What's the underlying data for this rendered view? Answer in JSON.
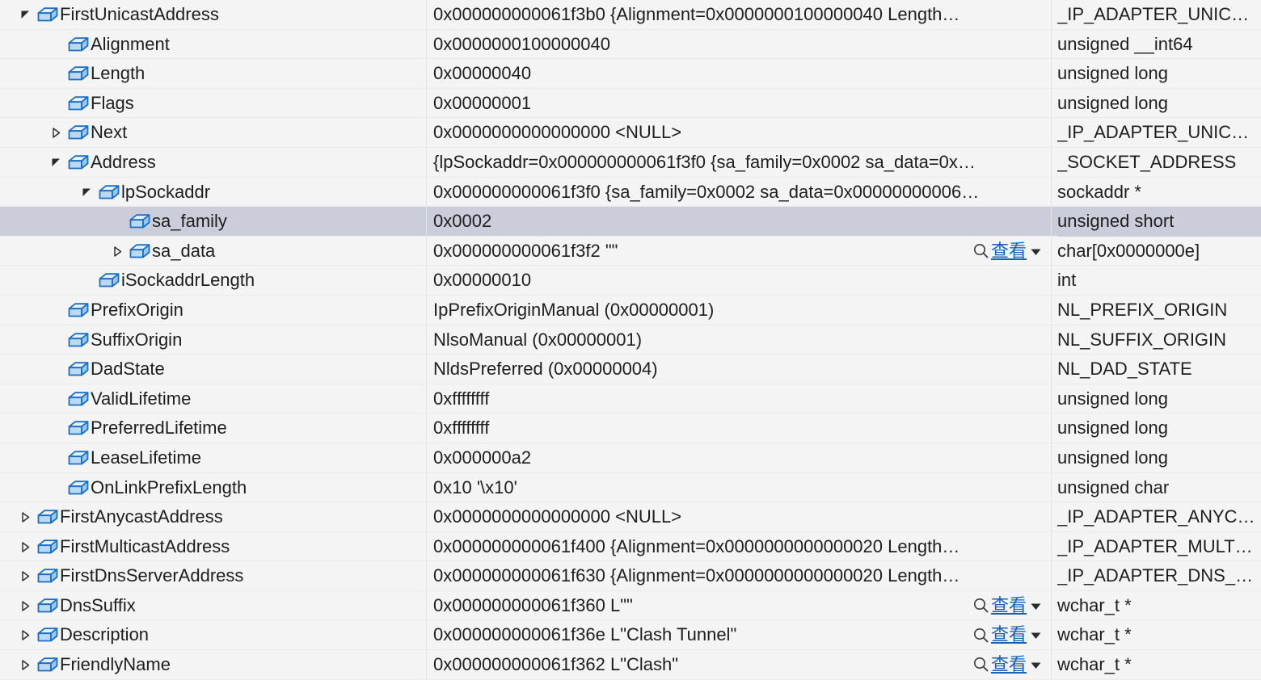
{
  "window": {
    "kind": "debugger-variable-tree",
    "selected_row_index": 7,
    "colors": {
      "row_background": "#f4f4f4",
      "row_divider": "#ebebeb",
      "selection": "#cbcdda",
      "text": "#1e1e1e",
      "link": "#1763b5",
      "icon_outline": "#1a6fc4",
      "icon_fill": "#cfe2f5"
    }
  },
  "visualizer": {
    "label": "查看",
    "magnifier_icon": "search-icon",
    "caret_icon": "chevron-down-icon"
  },
  "icons": {
    "field": "field-cube-icon",
    "expanded": "triangle-expanded-icon",
    "collapsed": "triangle-collapsed-icon",
    "pin": "pin-icon"
  },
  "rows": [
    {
      "indent": 1,
      "twisty": "expanded",
      "name": "FirstUnicastAddress",
      "pin": true,
      "value": "0x000000000061f3b0 {Alignment=0x0000000100000040 Length…",
      "visualizer": false,
      "type": "_IP_ADAPTER_UNIC…"
    },
    {
      "indent": 2,
      "twisty": "none",
      "name": "Alignment",
      "pin": false,
      "value": "0x0000000100000040",
      "visualizer": false,
      "type": "unsigned __int64"
    },
    {
      "indent": 2,
      "twisty": "none",
      "name": "Length",
      "pin": false,
      "value": "0x00000040",
      "visualizer": false,
      "type": "unsigned long"
    },
    {
      "indent": 2,
      "twisty": "none",
      "name": "Flags",
      "pin": false,
      "value": "0x00000001",
      "visualizer": false,
      "type": "unsigned long"
    },
    {
      "indent": 2,
      "twisty": "collapsed",
      "name": "Next",
      "pin": false,
      "value": "0x0000000000000000 <NULL>",
      "visualizer": false,
      "type": "_IP_ADAPTER_UNIC…"
    },
    {
      "indent": 2,
      "twisty": "expanded",
      "name": "Address",
      "pin": false,
      "value": "{lpSockaddr=0x000000000061f3f0 {sa_family=0x0002 sa_data=0x…",
      "visualizer": false,
      "type": "_SOCKET_ADDRESS"
    },
    {
      "indent": 3,
      "twisty": "expanded",
      "name": "lpSockaddr",
      "pin": false,
      "value": "0x000000000061f3f0 {sa_family=0x0002 sa_data=0x00000000006…",
      "visualizer": false,
      "type": "sockaddr *"
    },
    {
      "indent": 4,
      "twisty": "none",
      "name": "sa_family",
      "pin": false,
      "value": "0x0002",
      "visualizer": false,
      "type": "unsigned short"
    },
    {
      "indent": 4,
      "twisty": "collapsed",
      "name": "sa_data",
      "pin": false,
      "value": "0x000000000061f3f2 \"\"",
      "visualizer": true,
      "type": "char[0x0000000e]"
    },
    {
      "indent": 3,
      "twisty": "none",
      "name": "iSockaddrLength",
      "pin": false,
      "value": "0x00000010",
      "visualizer": false,
      "type": "int"
    },
    {
      "indent": 2,
      "twisty": "none",
      "name": "PrefixOrigin",
      "pin": false,
      "value": "IpPrefixOriginManual (0x00000001)",
      "visualizer": false,
      "type": "NL_PREFIX_ORIGIN"
    },
    {
      "indent": 2,
      "twisty": "none",
      "name": "SuffixOrigin",
      "pin": false,
      "value": "NlsoManual (0x00000001)",
      "visualizer": false,
      "type": "NL_SUFFIX_ORIGIN"
    },
    {
      "indent": 2,
      "twisty": "none",
      "name": "DadState",
      "pin": false,
      "value": "NldsPreferred (0x00000004)",
      "visualizer": false,
      "type": "NL_DAD_STATE"
    },
    {
      "indent": 2,
      "twisty": "none",
      "name": "ValidLifetime",
      "pin": false,
      "value": "0xffffffff",
      "visualizer": false,
      "type": "unsigned long"
    },
    {
      "indent": 2,
      "twisty": "none",
      "name": "PreferredLifetime",
      "pin": false,
      "value": "0xffffffff",
      "visualizer": false,
      "type": "unsigned long"
    },
    {
      "indent": 2,
      "twisty": "none",
      "name": "LeaseLifetime",
      "pin": false,
      "value": "0x000000a2",
      "visualizer": false,
      "type": "unsigned long"
    },
    {
      "indent": 2,
      "twisty": "none",
      "name": "OnLinkPrefixLength",
      "pin": false,
      "value": "0x10 '\\x10'",
      "visualizer": false,
      "type": "unsigned char"
    },
    {
      "indent": 1,
      "twisty": "collapsed",
      "name": "FirstAnycastAddress",
      "pin": false,
      "value": "0x0000000000000000 <NULL>",
      "visualizer": false,
      "type": "_IP_ADAPTER_ANYC…"
    },
    {
      "indent": 1,
      "twisty": "collapsed",
      "name": "FirstMulticastAddress",
      "pin": false,
      "value": "0x000000000061f400 {Alignment=0x0000000000000020 Length…",
      "visualizer": false,
      "type": "_IP_ADAPTER_MULT…"
    },
    {
      "indent": 1,
      "twisty": "collapsed",
      "name": "FirstDnsServerAddress",
      "pin": false,
      "value": "0x000000000061f630 {Alignment=0x0000000000000020 Length…",
      "visualizer": false,
      "type": "_IP_ADAPTER_DNS_…"
    },
    {
      "indent": 1,
      "twisty": "collapsed",
      "name": "DnsSuffix",
      "pin": false,
      "value": "0x000000000061f360 L\"\"",
      "visualizer": true,
      "type": "wchar_t *"
    },
    {
      "indent": 1,
      "twisty": "collapsed",
      "name": "Description",
      "pin": false,
      "value": "0x000000000061f36e L\"Clash Tunnel\"",
      "visualizer": true,
      "type": "wchar_t *"
    },
    {
      "indent": 1,
      "twisty": "collapsed",
      "name": "FriendlyName",
      "pin": false,
      "value": "0x000000000061f362 L\"Clash\"",
      "visualizer": true,
      "type": "wchar_t *"
    }
  ]
}
